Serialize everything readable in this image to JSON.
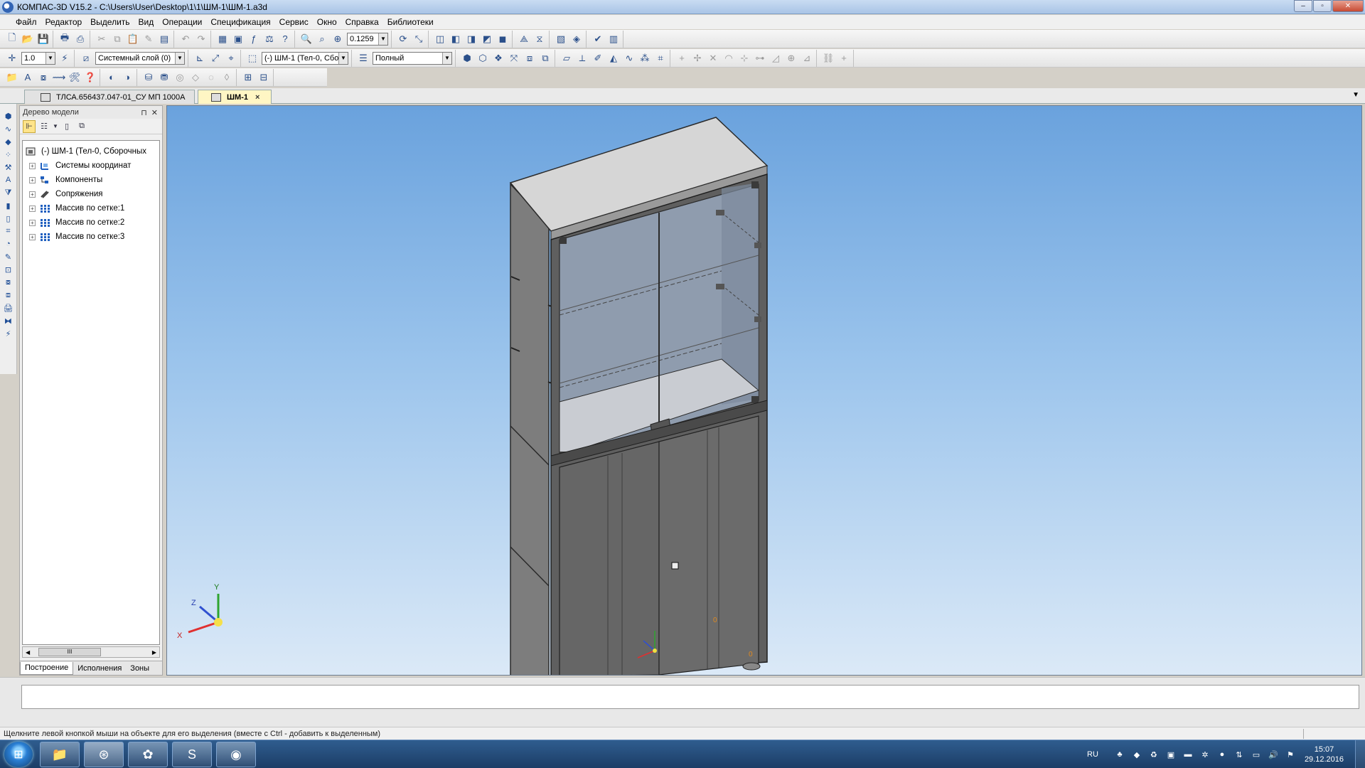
{
  "window": {
    "title": "КОМПАС-3D V15.2  - C:\\Users\\User\\Desktop\\1\\1\\ШМ-1\\ШМ-1.a3d",
    "minimize": "–",
    "restore": "▫",
    "close": "✕"
  },
  "menu": [
    "Файл",
    "Редактор",
    "Выделить",
    "Вид",
    "Операции",
    "Спецификация",
    "Сервис",
    "Окно",
    "Справка",
    "Библиотеки"
  ],
  "toolbar": {
    "zoom_value": "0.1259",
    "step_value": "1.0",
    "layer_select": "Системный слой (0)",
    "body_select": "(-) ШМ-1 (Тел-0, Сбо",
    "display_mode": "Полный"
  },
  "tabs": [
    {
      "label": "ТЛСА.656437.047-01_СУ МП 1000А",
      "active": false
    },
    {
      "label": "ШМ-1",
      "active": true
    }
  ],
  "tree": {
    "header": "Дерево модели",
    "pin": "⊓",
    "close": "✕",
    "root": "(-) ШМ-1 (Тел-0, Сборочных",
    "items": [
      {
        "label": "Системы координат",
        "icon": "coordinate-systems-icon"
      },
      {
        "label": "Компоненты",
        "icon": "components-icon"
      },
      {
        "label": "Сопряжения",
        "icon": "mates-icon"
      },
      {
        "label": "Массив по сетке:1",
        "icon": "grid-array-icon"
      },
      {
        "label": "Массив по сетке:2",
        "icon": "grid-array-icon"
      },
      {
        "label": "Массив по сетке:3",
        "icon": "grid-array-icon"
      }
    ],
    "scroll_thumb": "III",
    "bottom_tabs": [
      "Построение",
      "Исполнения",
      "Зоны"
    ]
  },
  "axes": {
    "x": "X",
    "y": "Y",
    "z": "Z"
  },
  "status": "Щелкните левой кнопкой мыши на объекте для его выделения (вместе с Ctrl - добавить к выделенным)",
  "taskbar": {
    "lang": "RU",
    "time": "15:07",
    "date": "29.12.2016"
  },
  "colors": {
    "viewport_top": "#6aa2dd",
    "viewport_bottom": "#dbe9f7",
    "cabinet_body": "#6e6e6e",
    "cabinet_top": "#d6d6d6",
    "glass": "#8a97a8",
    "active_tab": "#fff6c4"
  }
}
